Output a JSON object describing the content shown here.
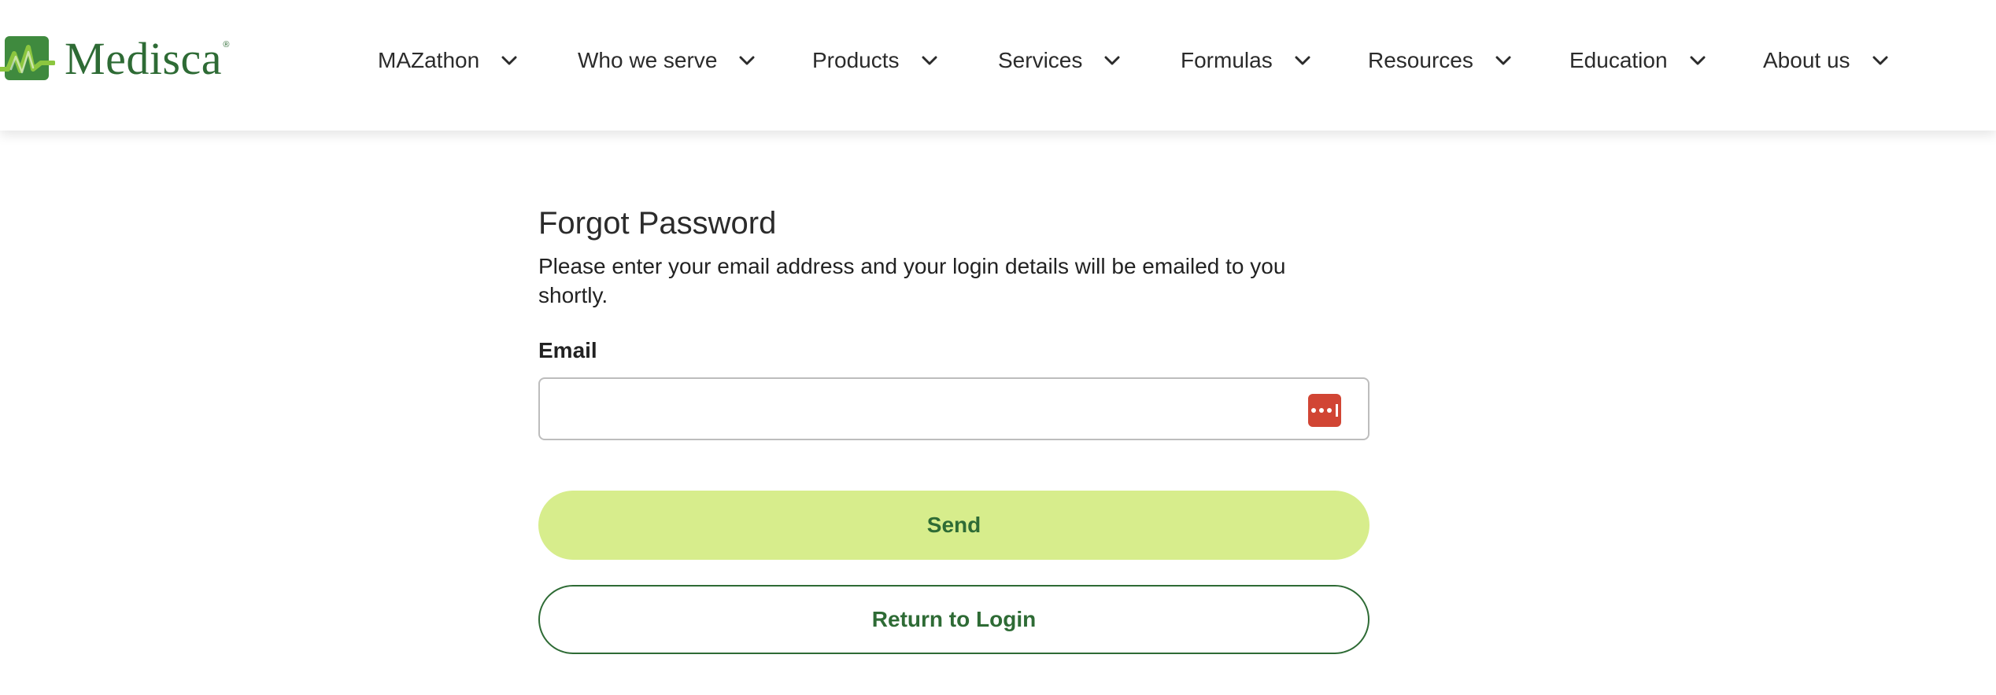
{
  "brand": {
    "name": "Medisca",
    "reg_mark": "®",
    "colors": {
      "primary": "#2e6b35",
      "accent_light": "#d7ed8c",
      "logo_green": "#3f8a3e",
      "logo_lime": "#8cc63f"
    }
  },
  "nav": {
    "items": [
      {
        "label": "MAZathon",
        "icon": "chevron-down-icon"
      },
      {
        "label": "Who we serve",
        "icon": "chevron-down-icon"
      },
      {
        "label": "Products",
        "icon": "chevron-down-icon"
      },
      {
        "label": "Services",
        "icon": "chevron-down-icon"
      },
      {
        "label": "Formulas",
        "icon": "chevron-down-icon"
      },
      {
        "label": "Resources",
        "icon": "chevron-down-icon"
      },
      {
        "label": "Education",
        "icon": "chevron-down-icon"
      },
      {
        "label": "About us",
        "icon": "chevron-down-icon"
      }
    ]
  },
  "form": {
    "title": "Forgot Password",
    "description": "Please enter your email address and your login details will be emailed to you shortly.",
    "email_label": "Email",
    "email_value": "",
    "email_placeholder": "",
    "password_manager_icon": "password-manager-icon",
    "password_manager_color": "#d14534",
    "send_label": "Send",
    "return_label": "Return to Login"
  }
}
